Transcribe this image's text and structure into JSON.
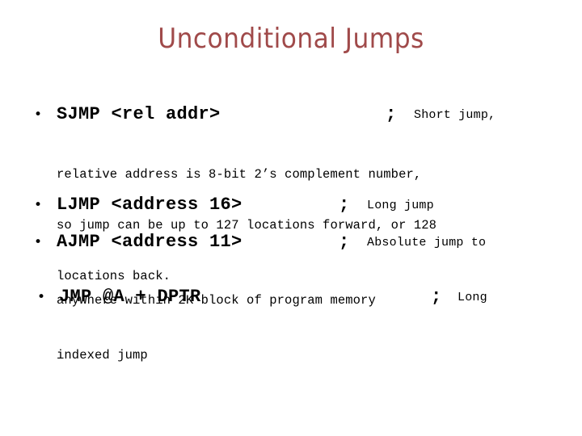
{
  "slide": {
    "title": "Unconditional Jumps",
    "title_color": "#a04a4a",
    "background_color": "#ffffff",
    "bullet_glyph": "•"
  },
  "bullets": [
    {
      "code": "SJMP <rel addr>",
      "separator": ";",
      "comment": "Short jump,",
      "subtext_lines": [
        "relative address is 8-bit 2’s complement number,",
        "so jump can be up to 127 locations forward, or 128",
        "locations back."
      ]
    },
    {
      "code": "LJMP <address 16>",
      "separator": ";",
      "comment": "Long jump",
      "subtext_lines": []
    },
    {
      "code": "AJMP <address 11>",
      "separator": ";",
      "comment": "Absolute jump to",
      "subtext_lines": [
        "anywhere within 2K block of program memory"
      ]
    },
    {
      "code": "JMP @A + DPTR",
      "separator": ";",
      "comment": "Long",
      "subtext_lines": [
        "indexed jump"
      ]
    }
  ]
}
